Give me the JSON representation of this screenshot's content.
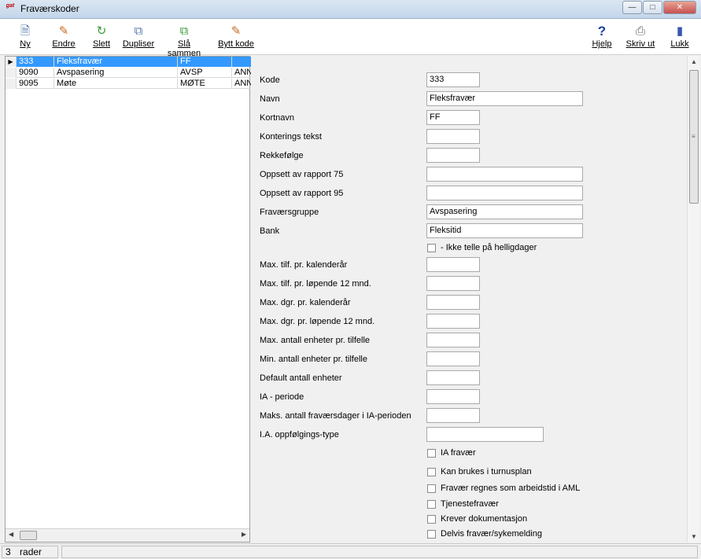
{
  "window": {
    "title": "Fraværskoder",
    "app_icon_text": "gat"
  },
  "toolbar": {
    "buttons": [
      {
        "label": "Ny",
        "icon": "new-document-icon"
      },
      {
        "label": "Endre",
        "icon": "edit-icon"
      },
      {
        "label": "Slett",
        "icon": "delete-icon"
      },
      {
        "label": "Dupliser",
        "icon": "duplicate-icon"
      },
      {
        "label": "Slå sammen",
        "icon": "merge-icon"
      },
      {
        "label": "Bytt kode",
        "icon": "switch-code-icon"
      },
      {
        "label": "Hjelp",
        "icon": "help-icon"
      },
      {
        "label": "Skriv ut",
        "icon": "printer-icon"
      },
      {
        "label": "Lukk",
        "icon": "close-door-icon"
      }
    ]
  },
  "grid": {
    "rows": [
      {
        "code": "333",
        "name": "Fleksfravær",
        "short": "FF",
        "extra": "",
        "selected": true
      },
      {
        "code": "9090",
        "name": "Avspasering",
        "short": "AVSP",
        "extra": "ANN"
      },
      {
        "code": "9095",
        "name": "Møte",
        "short": "MØTE",
        "extra": "ANN"
      }
    ]
  },
  "form": {
    "fields": [
      {
        "label": "Kode",
        "value": "333"
      },
      {
        "label": "Navn",
        "value": "Fleksfravær"
      },
      {
        "label": "Kortnavn",
        "value": "FF"
      },
      {
        "label": "Konterings tekst",
        "value": ""
      },
      {
        "label": "Rekkefølge",
        "value": ""
      },
      {
        "label": "Oppsett av rapport 75",
        "value": ""
      },
      {
        "label": "Oppsett av rapport 95",
        "value": ""
      },
      {
        "label": "Fraværsgruppe",
        "value": "Avspasering"
      },
      {
        "label": "Bank",
        "value": "Fleksitid"
      }
    ],
    "holiday_checkbox": {
      "label": "- Ikke telle på helligdager",
      "checked": false
    },
    "limits": [
      {
        "label": "Max. tilf. pr. kalenderår",
        "value": ""
      },
      {
        "label": "Max. tilf. pr. løpende 12 mnd.",
        "value": ""
      },
      {
        "label": "Max. dgr. pr. kalenderår",
        "value": ""
      },
      {
        "label": "Max. dgr. pr. løpende 12 mnd.",
        "value": ""
      },
      {
        "label": "Max. antall enheter pr. tilfelle",
        "value": ""
      },
      {
        "label": "Min. antall enheter pr. tilfelle",
        "value": ""
      },
      {
        "label": "Default antall enheter",
        "value": ""
      },
      {
        "label": "IA - periode",
        "value": ""
      },
      {
        "label": "Maks. antall fraværsdager i IA-perioden",
        "value": ""
      },
      {
        "label": "I.A. oppfølgings-type",
        "value": ""
      }
    ],
    "checkboxes": [
      {
        "label": "IA fravær",
        "checked": false
      },
      {
        "label": "Kan brukes i turnusplan",
        "checked": false
      },
      {
        "label": "Fravær regnes som arbeidstid i AML",
        "checked": false
      },
      {
        "label": "Tjenestefravær",
        "checked": false
      },
      {
        "label": "Krever dokumentasjon",
        "checked": false
      },
      {
        "label": "Delvis fravær/sykemelding",
        "checked": false
      }
    ]
  },
  "status": {
    "count": "3",
    "label": "rader"
  }
}
